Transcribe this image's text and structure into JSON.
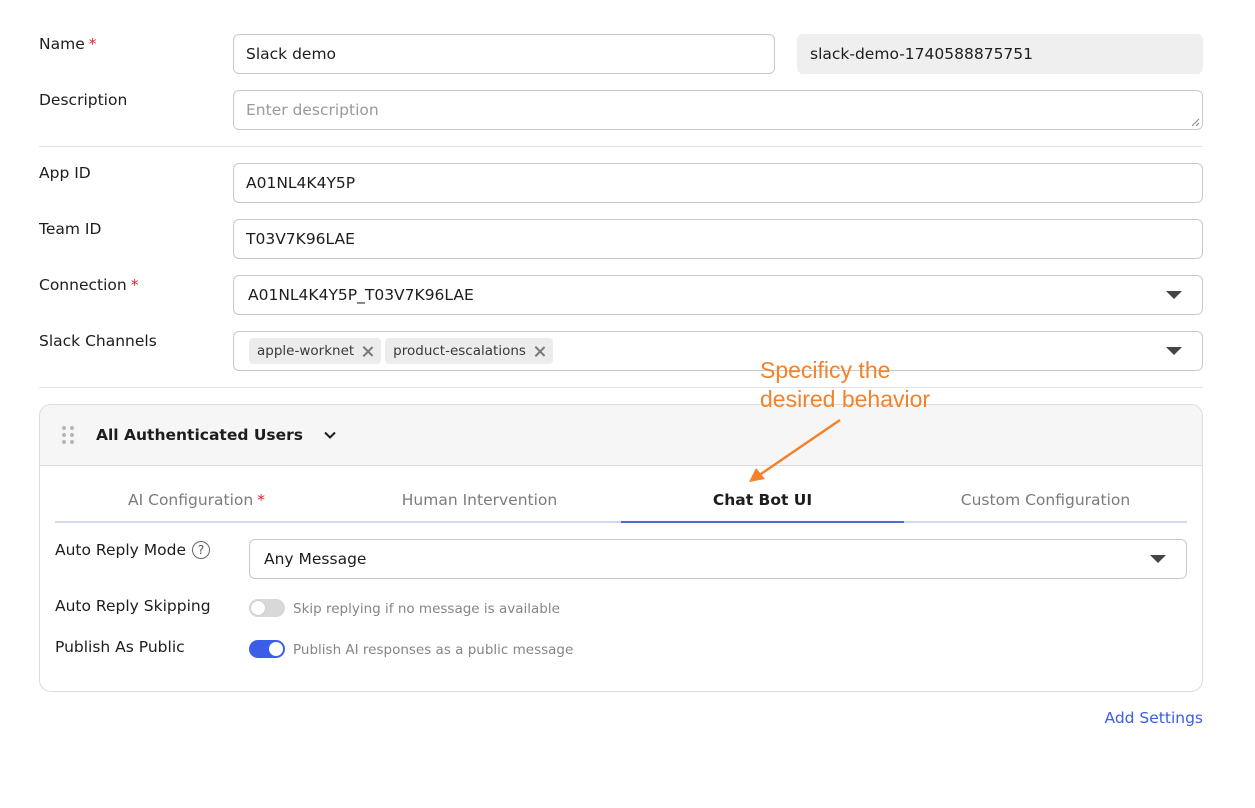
{
  "form": {
    "name": {
      "label": "Name",
      "required_mark": "*",
      "value": "Slack demo",
      "slug": "slack-demo-1740588875751"
    },
    "description": {
      "label": "Description",
      "placeholder": "Enter description",
      "value": ""
    },
    "app_id": {
      "label": "App ID",
      "value": "A01NL4K4Y5P"
    },
    "team_id": {
      "label": "Team ID",
      "value": "T03V7K96LAE"
    },
    "connection": {
      "label": "Connection",
      "required_mark": "*",
      "selected": "A01NL4K4Y5P_T03V7K96LAE"
    },
    "slack_channels": {
      "label": "Slack Channels",
      "chips": [
        "apple-worknet",
        "product-escalations"
      ]
    }
  },
  "panel": {
    "title": "All Authenticated Users",
    "tabs": [
      {
        "label": "AI Configuration",
        "required_mark": "*",
        "active": false
      },
      {
        "label": "Human Intervention",
        "active": false
      },
      {
        "label": "Chat Bot UI",
        "active": true
      },
      {
        "label": "Custom Configuration",
        "active": false
      }
    ],
    "auto_reply_mode": {
      "label": "Auto Reply Mode",
      "help_icon": "?",
      "selected": "Any Message"
    },
    "auto_reply_skipping": {
      "label": "Auto Reply Skipping",
      "toggle_label": "Skip replying if no message is available",
      "enabled": false
    },
    "publish_as_public": {
      "label": "Publish As Public",
      "toggle_label": "Publish AI responses as a public message",
      "enabled": true
    }
  },
  "footer": {
    "add_settings": "Add Settings"
  },
  "annotation": {
    "line1": "Specificy the",
    "line2": "desired behavior",
    "color": "#f4822b"
  },
  "colors": {
    "accent": "#3b5de7",
    "required": "#e5223a",
    "tab_underline": "#4c6bd8"
  }
}
